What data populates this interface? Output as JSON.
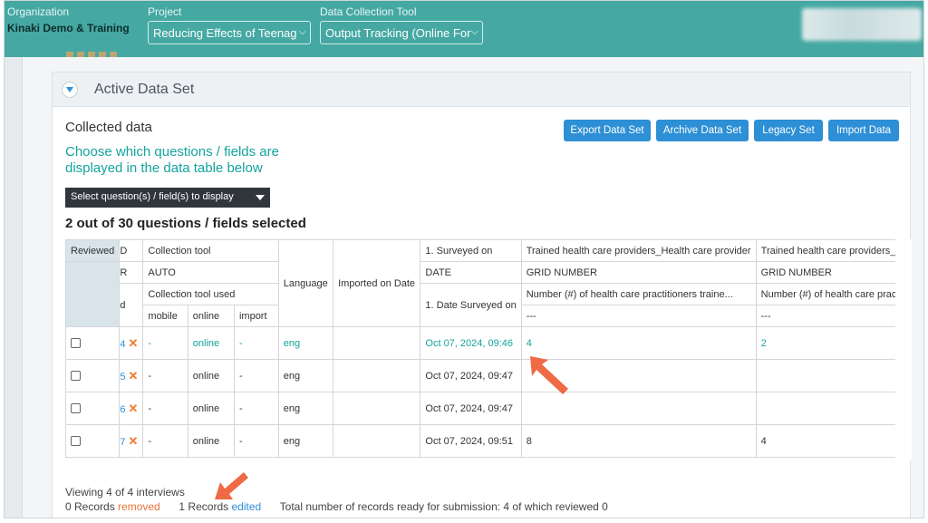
{
  "topbar": {
    "org_label": "Organization",
    "org_value": "Kinaki Demo & Training",
    "project_label": "Project",
    "project_value": "Reducing Effects of Teenag",
    "tool_label": "Data Collection Tool",
    "tool_value": "Output Tracking (Online For"
  },
  "panel": {
    "title": "Active Data Set",
    "collected_label": "Collected data",
    "choose_text": "Choose which questions / fields are displayed in the data table below",
    "dropdown_label": "Select question(s) / field(s) to display",
    "selected_count": "2 out of 30 questions / fields selected",
    "buttons": [
      "Export Data Set",
      "Archive Data Set",
      "Legacy Set",
      "Import Data"
    ]
  },
  "table": {
    "header": {
      "reviewed": "Reviewed",
      "id_frag": "D",
      "r_frag": "R",
      "d_frag": "d",
      "collection_tool": "Collection tool",
      "auto": "AUTO",
      "collection_tool_used": "Collection tool used",
      "mobile": "mobile",
      "online": "online",
      "import": "import",
      "language": "Language",
      "imported_on": "Imported on Date",
      "surveyed_on": "1. Surveyed on",
      "date": "DATE",
      "date_surveyed_on": "1. Date Surveyed on",
      "q1_title": "Trained health care providers_Health care provider",
      "q1_type": "GRID NUMBER",
      "q1_desc": "Number (#) of health care practitioners traine...",
      "q1_dash": "---",
      "q2_title": "Trained health care providers_H",
      "q2_type": "GRID NUMBER",
      "q2_desc": "Number (#) of health care prac",
      "q2_dash": "---"
    },
    "rows": [
      {
        "id": "4",
        "mobile": "-",
        "online": "online",
        "import": "-",
        "language": "eng",
        "imported": "",
        "surveyed": "Oct 07, 2024, 09:46",
        "q1": "4",
        "q2": "2",
        "highlight": true
      },
      {
        "id": "5",
        "mobile": "-",
        "online": "online",
        "import": "-",
        "language": "eng",
        "imported": "",
        "surveyed": "Oct 07, 2024, 09:47",
        "q1": "",
        "q2": "",
        "highlight": false
      },
      {
        "id": "6",
        "mobile": "-",
        "online": "online",
        "import": "-",
        "language": "eng",
        "imported": "",
        "surveyed": "Oct 07, 2024, 09:47",
        "q1": "",
        "q2": "",
        "highlight": false
      },
      {
        "id": "7",
        "mobile": "-",
        "online": "online",
        "import": "-",
        "language": "eng",
        "imported": "",
        "surveyed": "Oct 07, 2024, 09:51",
        "q1": "8",
        "q2": "4",
        "highlight": false
      }
    ]
  },
  "footer": {
    "viewing": "Viewing 4 of 4 interviews",
    "removed_prefix": "0 Records",
    "removed_word": "removed",
    "edited_prefix": "1 Records",
    "edited_word": "edited",
    "total": "Total number of records ready for submission: 4 of which reviewed 0"
  },
  "colors": {
    "topbar": "#45a8a3",
    "accent_blue": "#2d8fd5",
    "teal_text": "#14a39d",
    "orange": "#f07a2a",
    "arrow": "#ef6a45"
  }
}
